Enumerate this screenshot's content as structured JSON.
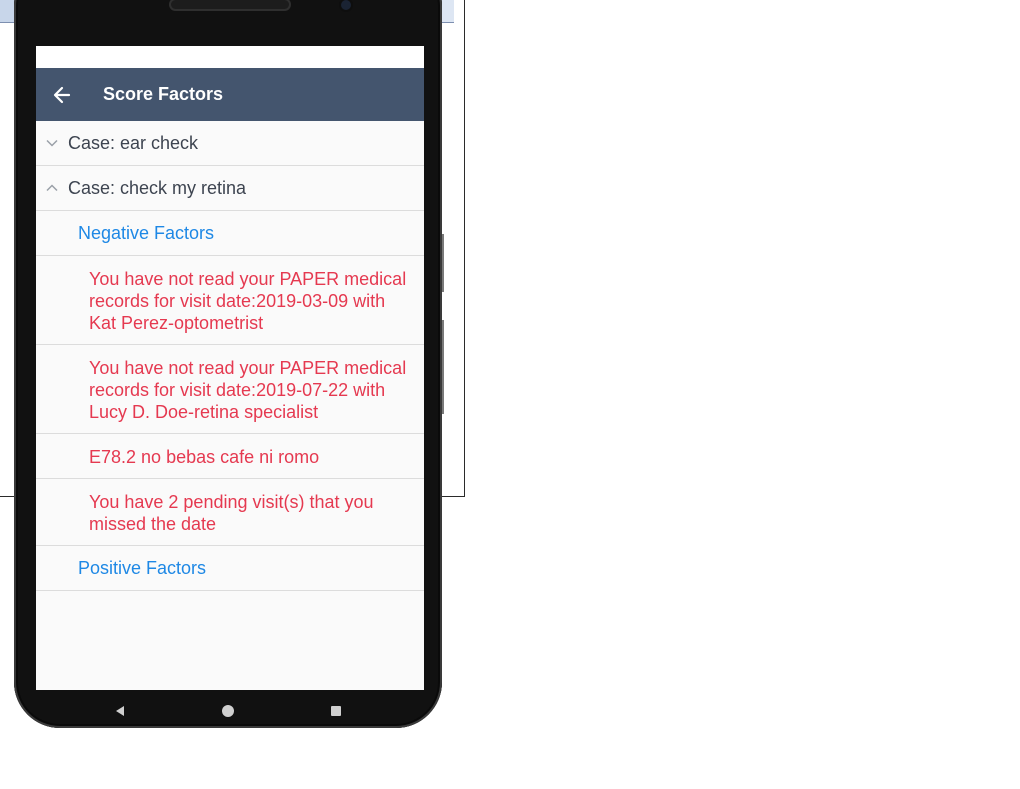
{
  "app_bar": {
    "title": "Score Factors",
    "back_icon": "arrow-left-icon",
    "background": "#44556e"
  },
  "cases": [
    {
      "label": "Case: ear check",
      "expanded": false,
      "icon": "chevron-down-icon"
    },
    {
      "label": "Case: check my retina",
      "expanded": true,
      "icon": "chevron-up-icon",
      "negative_factors_label": "Negative Factors",
      "negative_factors": [
        "You have not read your PAPER medical records for visit date:2019-03-09 with Kat Perez-optometrist",
        "You have not read your PAPER medical records for visit date:2019-07-22 with Lucy D. Doe-retina specialist",
        "E78.2 no bebas cafe ni romo",
        "You have 2 pending visit(s) that you missed the date"
      ],
      "positive_factors_label": "Positive Factors"
    }
  ],
  "colors": {
    "accent_blue": "#1e88e5",
    "negative_red": "#e53950",
    "case_text": "#3d4450"
  },
  "nav_bar": {
    "icons": [
      "nav-back-icon",
      "nav-home-icon",
      "nav-recents-icon"
    ]
  }
}
